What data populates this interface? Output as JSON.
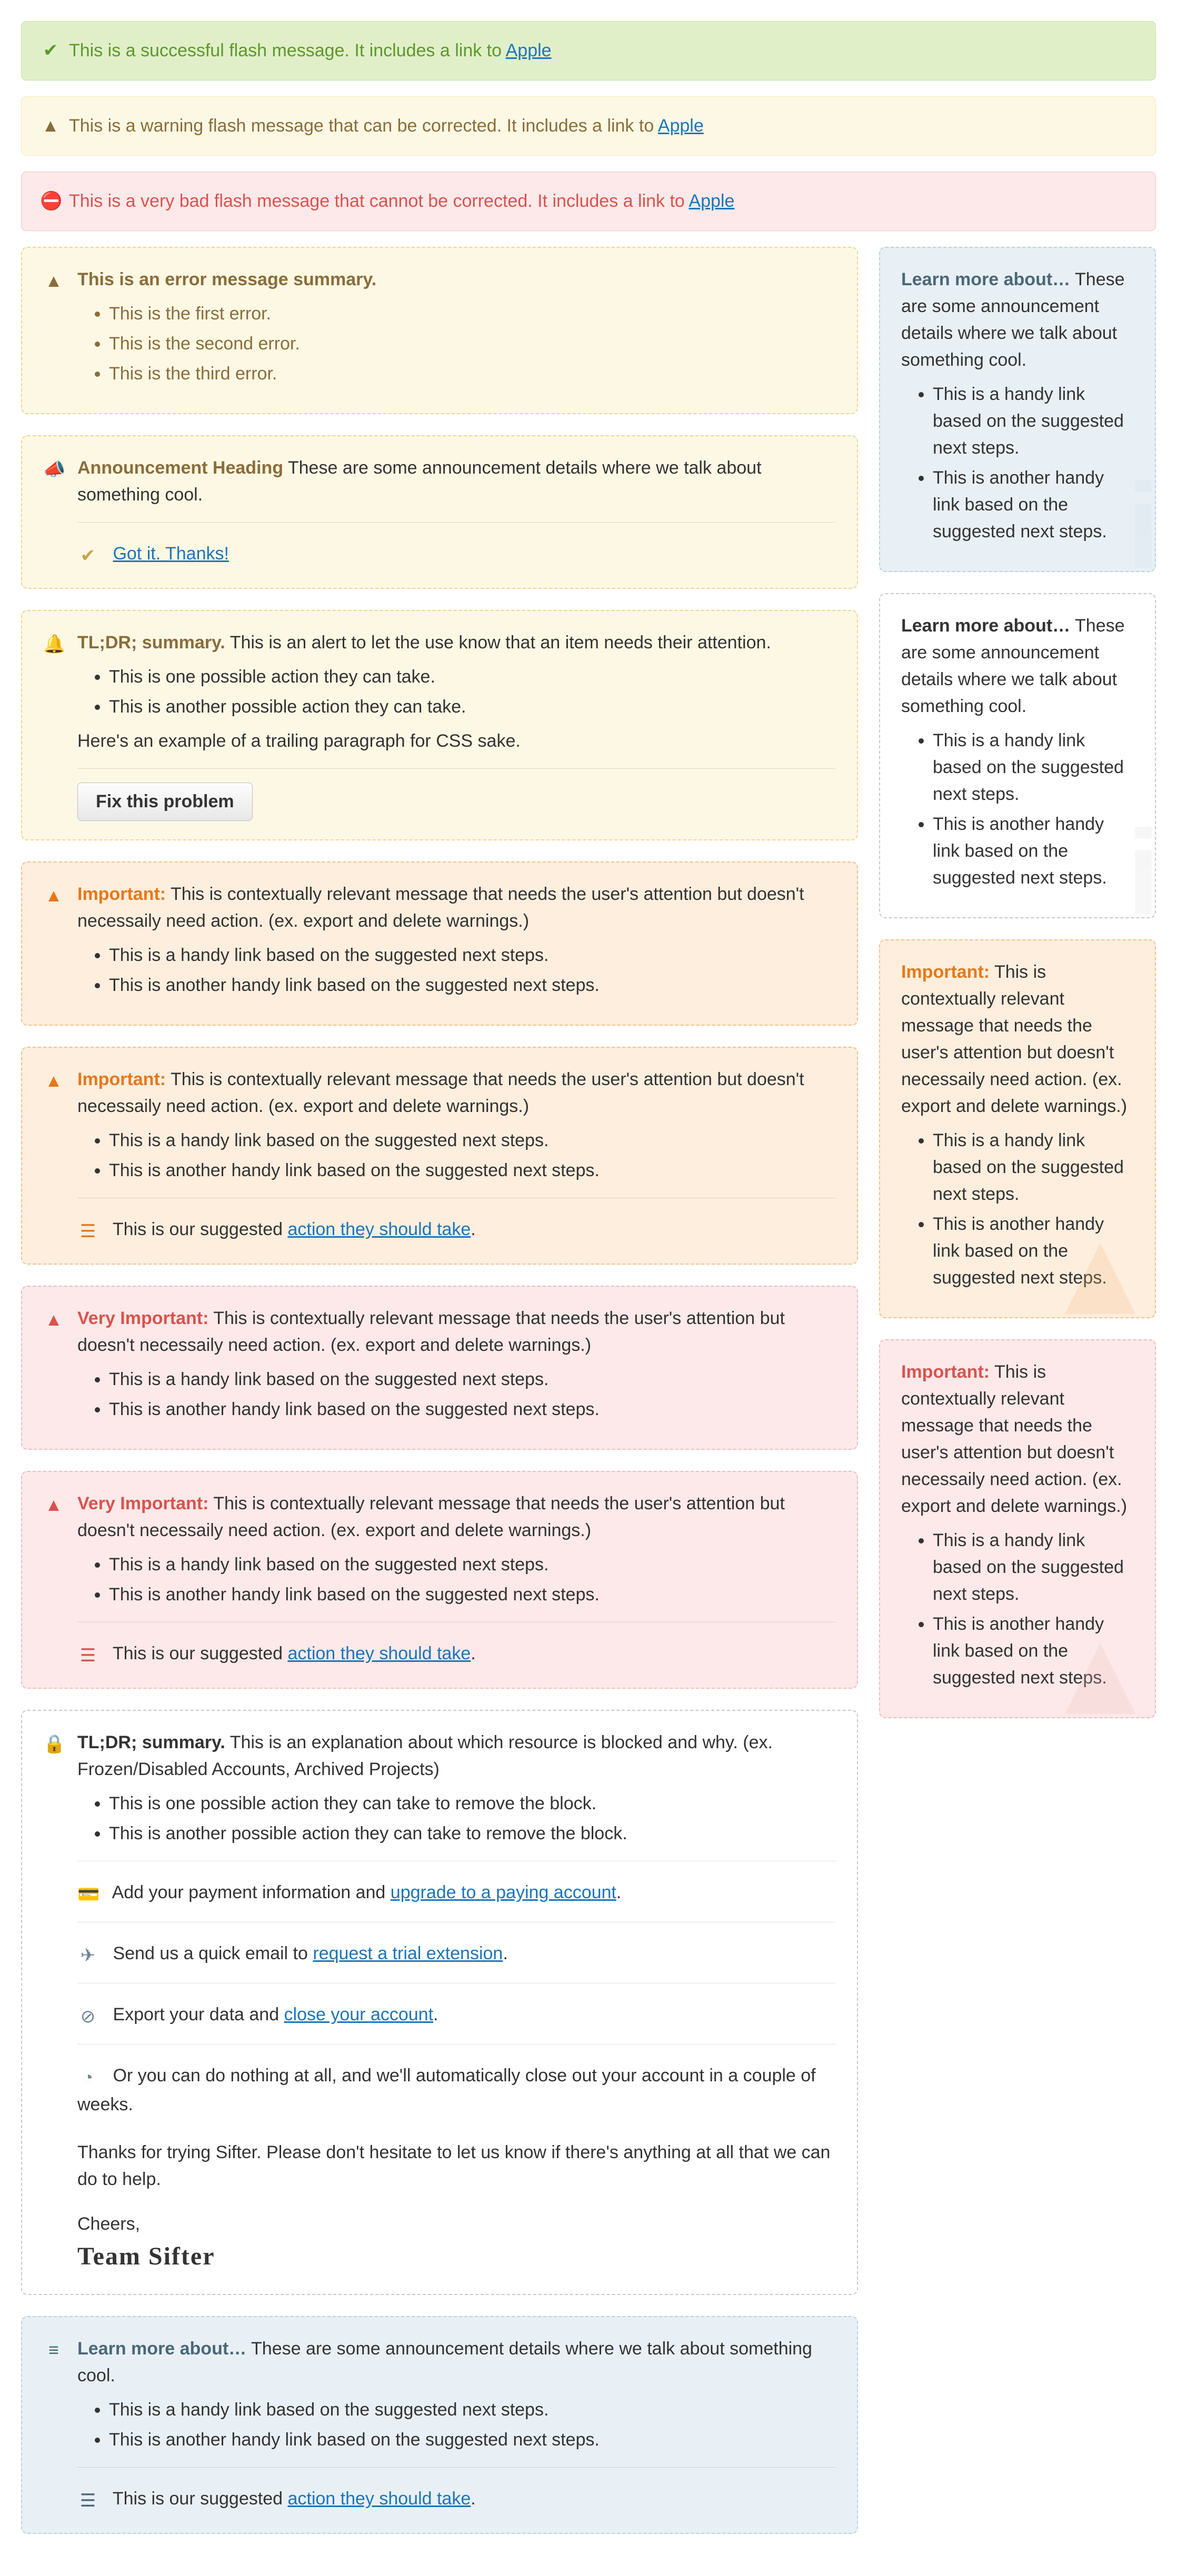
{
  "flash": {
    "success": {
      "text": "This is a successful flash message. It includes a link to ",
      "link": "Apple"
    },
    "warning": {
      "text": "This is a warning flash message that can be corrected. It includes a link to ",
      "link": "Apple"
    },
    "error": {
      "text": "This is a very bad flash message that cannot be corrected. It includes a link to ",
      "link": "Apple"
    }
  },
  "error_box": {
    "summary": "This is an error message summary.",
    "items": [
      "This is the first error.",
      "This is the second error.",
      "This is the third error."
    ]
  },
  "announcement": {
    "heading": "Announcement Heading",
    "text": " These are some announcement details where we talk about something cool.",
    "got_it": "Got it. Thanks!"
  },
  "alert": {
    "summary": "TL;DR; summary.",
    "text": " This is an alert to let the use know that an item needs their attention.",
    "items": [
      "This is one possible action they can take.",
      "This is another possible action they can take."
    ],
    "trailing": "Here's an example of a trailing paragraph for CSS sake.",
    "button": "Fix this problem"
  },
  "important": {
    "label": "Important:",
    "text": " This is contextually relevant message that needs the user's attention but doesn't necessaily need action. (ex. export and delete warnings.)",
    "items": [
      "This is a handy link based on the suggested next steps.",
      "This is another handy link based on the suggested next steps."
    ],
    "action_prefix": "This is our suggested ",
    "action_link": "action they should take",
    "action_suffix": "."
  },
  "very_important": {
    "label": "Very Important:",
    "text": " This is contextually relevant message that needs the user's attention but doesn't necessaily need action. (ex. export and delete warnings.)",
    "items": [
      "This is a handy link based on the suggested next steps.",
      "This is another handy link based on the suggested next steps."
    ]
  },
  "locked": {
    "summary": "TL;DR; summary.",
    "text": " This is an explanation about which resource is blocked and why. (ex. Frozen/Disabled Accounts, Archived Projects)",
    "items": [
      "This is one possible action they can take to remove the block.",
      "This is another possible action they can take to remove the block."
    ],
    "pay_pre": "Add your payment information and ",
    "pay_link": "upgrade to a paying account",
    "pay_post": ".",
    "email_pre": "Send us a quick email to ",
    "email_link": "request a trial extension",
    "email_post": ".",
    "export_pre": "Export your data and ",
    "export_link": "close your account",
    "export_post": ".",
    "nothing": "Or you can do nothing at all, and we'll automatically close out your account in a couple of weeks.",
    "thanks": "Thanks for trying Sifter. Please don't hesitate to let us know if there's anything at all that we can do to help.",
    "cheers": "Cheers,",
    "signature": "Team Sifter"
  },
  "learn_more": {
    "heading": "Learn more about…",
    "text": " These are some announcement details where we talk about something cool.",
    "items": [
      "This is a handy link based on the suggested next steps.",
      "This is another handy link based on the suggested next steps."
    ]
  },
  "icons": {
    "check": "✔",
    "warn": "▲",
    "stop": "⛔",
    "speaker": "📣",
    "bell": "🔔",
    "lock": "🔒",
    "sliders": "≡",
    "card": "💳",
    "plane": "✈",
    "ban": "⊘",
    "clock": "◔",
    "list": "☰"
  }
}
